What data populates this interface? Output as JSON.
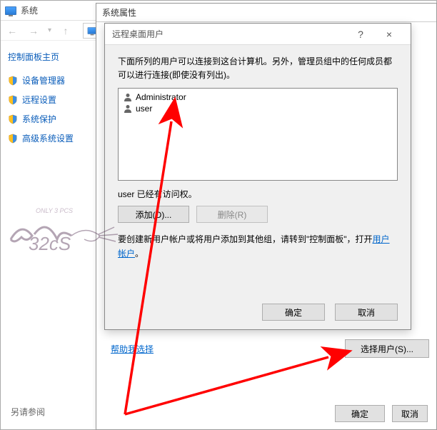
{
  "sys": {
    "title": "系统",
    "sidebar": {
      "home": "控制面板主页",
      "items": [
        {
          "label": "设备管理器"
        },
        {
          "label": "远程设置"
        },
        {
          "label": "系统保护"
        },
        {
          "label": "高级系统设置"
        }
      ],
      "see_also": "另请参阅"
    }
  },
  "props": {
    "title": "系统属性",
    "help_link": "帮助我选择",
    "select_user": "选择用户(S)...",
    "ok": "确定",
    "cancel": "取消"
  },
  "rdu": {
    "title": "远程桌面用户",
    "help": "?",
    "close": "×",
    "desc": "下面所列的用户可以连接到这台计算机。另外，管理员组中的任何成员都可以进行连接(即使没有列出)。",
    "users": [
      "Administrator",
      "user"
    ],
    "access_note": "user 已经有访问权。",
    "add": "添加(D)...",
    "remove": "删除(R)",
    "create_prefix": "要创建新用户帐户或将用户添加到其他组，请转到\"控制面板\"，打开",
    "create_link": "用户帐户",
    "create_suffix": "。",
    "ok": "确定",
    "cancel": "取消"
  }
}
